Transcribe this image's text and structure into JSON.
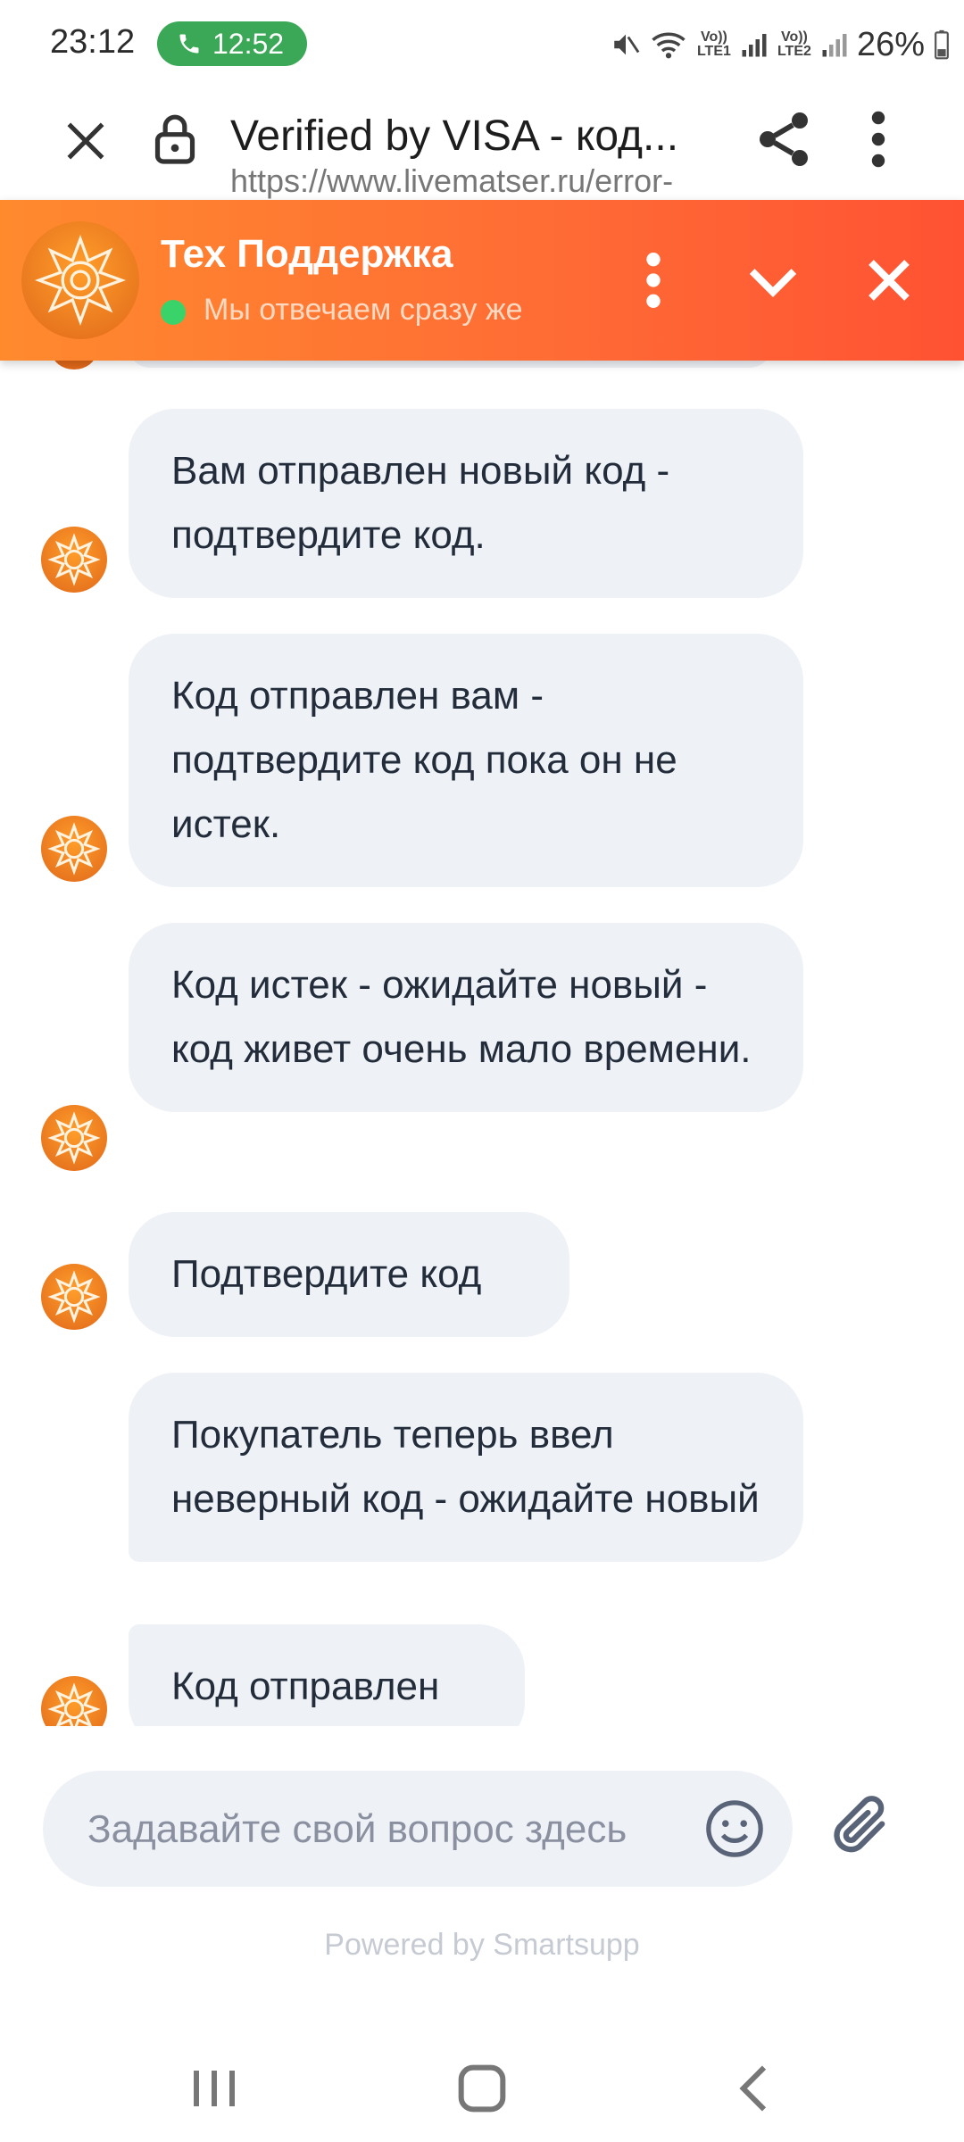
{
  "status_bar": {
    "time": "23:12",
    "call_timer": "12:52",
    "sim1": "Vo)) LTE1",
    "sim2": "Vo)) LTE2",
    "battery": "26%"
  },
  "browser": {
    "title": "Verified by VISA - код...",
    "url": "https://www.livematser.ru/error-"
  },
  "chat": {
    "agent_name": "Тех Поддержка",
    "agent_status": "Мы отвечаем сразу же",
    "messages": [
      "Вам отправлен новый код - подтвердите код.",
      "Код отправлен вам - подтвердите код пока он не истек.",
      "Код истек - ожидайте новый - код живет очень мало времени.",
      "Подтвердите код",
      "Покупатель теперь ввел неверный код - ожидайте новый",
      "Код отправлен"
    ],
    "input_placeholder": "Задавайте свой вопрос здесь",
    "powered_by": "Powered by Smartsupp"
  },
  "colors": {
    "header_gradient_start": "#ff8a2e",
    "header_gradient_end": "#ff5233",
    "bubble_bg": "#eef1f6",
    "online": "#3ad36a",
    "call_pill": "#3aa856"
  }
}
